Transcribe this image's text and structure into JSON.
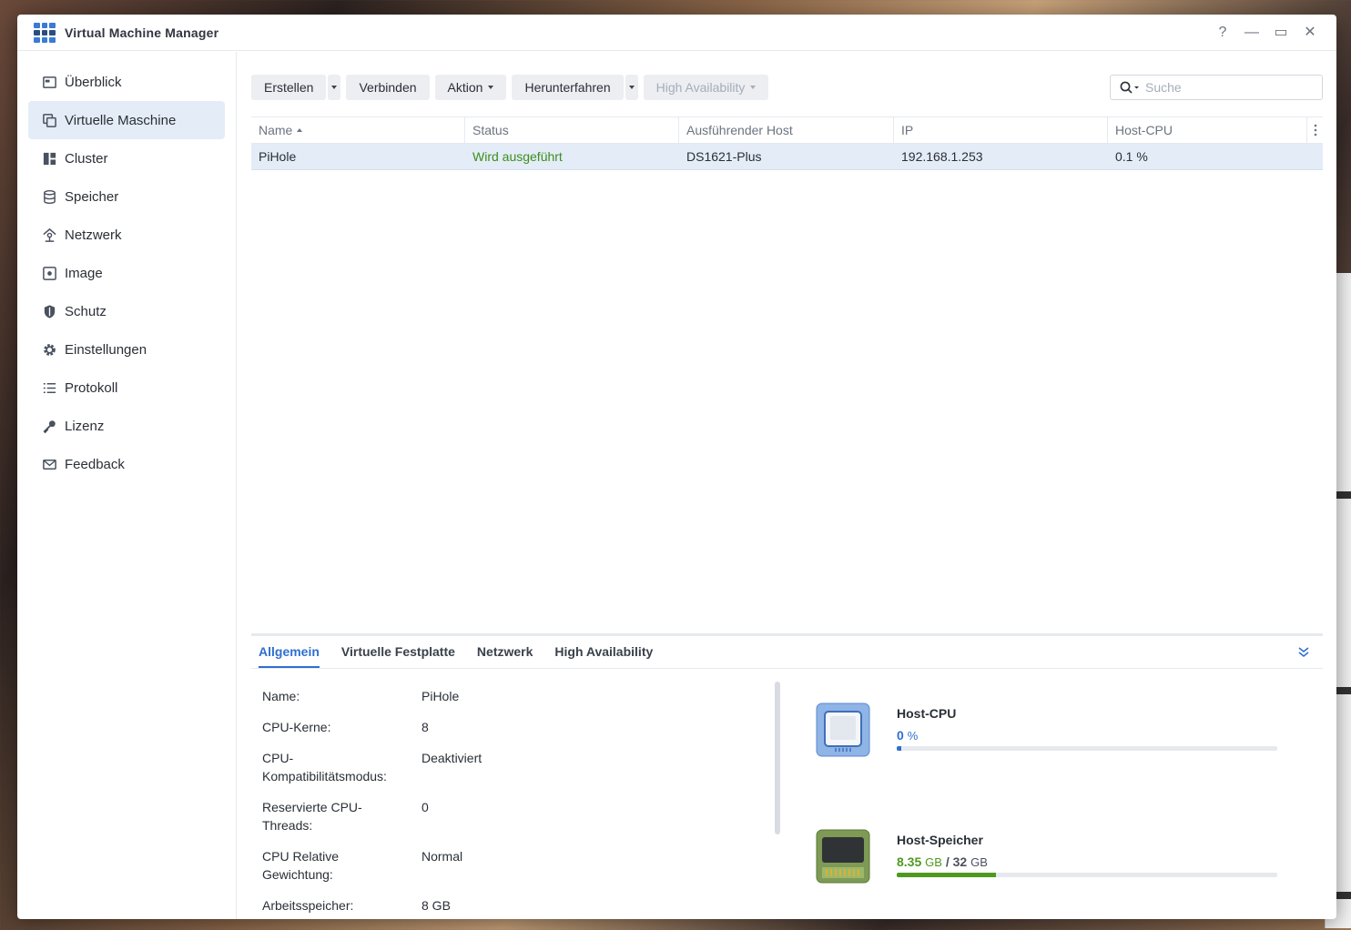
{
  "window": {
    "title": "Virtual Machine Manager",
    "controls": [
      "?",
      "—",
      "▭",
      "✕"
    ]
  },
  "sidebar": {
    "items": [
      {
        "label": "Überblick",
        "icon": "overview-icon",
        "active": false
      },
      {
        "label": "Virtuelle Maschine",
        "icon": "virtual-machine-icon",
        "active": true
      },
      {
        "label": "Cluster",
        "icon": "cluster-icon",
        "active": false
      },
      {
        "label": "Speicher",
        "icon": "storage-icon",
        "active": false
      },
      {
        "label": "Netzwerk",
        "icon": "network-icon",
        "active": false
      },
      {
        "label": "Image",
        "icon": "image-icon",
        "active": false
      },
      {
        "label": "Schutz",
        "icon": "shield-icon",
        "active": false
      },
      {
        "label": "Einstellungen",
        "icon": "gear-icon",
        "active": false
      },
      {
        "label": "Protokoll",
        "icon": "log-icon",
        "active": false
      },
      {
        "label": "Lizenz",
        "icon": "key-icon",
        "active": false
      },
      {
        "label": "Feedback",
        "icon": "mail-icon",
        "active": false
      }
    ]
  },
  "toolbar": {
    "create": "Erstellen",
    "connect": "Verbinden",
    "action": "Aktion",
    "shutdown": "Herunterfahren",
    "high_availability": "High Availability",
    "search_placeholder": "Suche"
  },
  "table": {
    "columns": [
      "Name",
      "Status",
      "Ausführender Host",
      "IP",
      "Host-CPU"
    ],
    "rows": [
      {
        "name": "PiHole",
        "status": "Wird ausgeführt",
        "host": "DS1621-Plus",
        "ip": "192.168.1.253",
        "cpu": "0.1 %"
      }
    ]
  },
  "detail": {
    "tabs": [
      "Allgemein",
      "Virtuelle Festplatte",
      "Netzwerk",
      "High Availability"
    ],
    "active_tab": "Allgemein",
    "properties": [
      {
        "key": "Name:",
        "value": "PiHole"
      },
      {
        "key": "CPU-Kerne:",
        "value": "8"
      },
      {
        "key": "CPU-\nKompatibilitätsmodus:",
        "value": "Deaktiviert"
      },
      {
        "key": "Reservierte CPU-\nThreads:",
        "value": "0"
      },
      {
        "key": "CPU Relative\nGewichtung:",
        "value": "Normal"
      },
      {
        "key": "Arbeitsspeicher:",
        "value": "8 GB"
      }
    ],
    "host_cpu": {
      "label": "Host-CPU",
      "value": "0",
      "unit": "%",
      "fraction": 0.013,
      "color": "#2f6fd1"
    },
    "host_memory": {
      "label": "Host-Speicher",
      "used": "8.35",
      "used_unit": "GB",
      "sep": "/",
      "total": "32",
      "total_unit": "GB",
      "fraction": 0.261,
      "color": "#4d9a1f"
    }
  }
}
